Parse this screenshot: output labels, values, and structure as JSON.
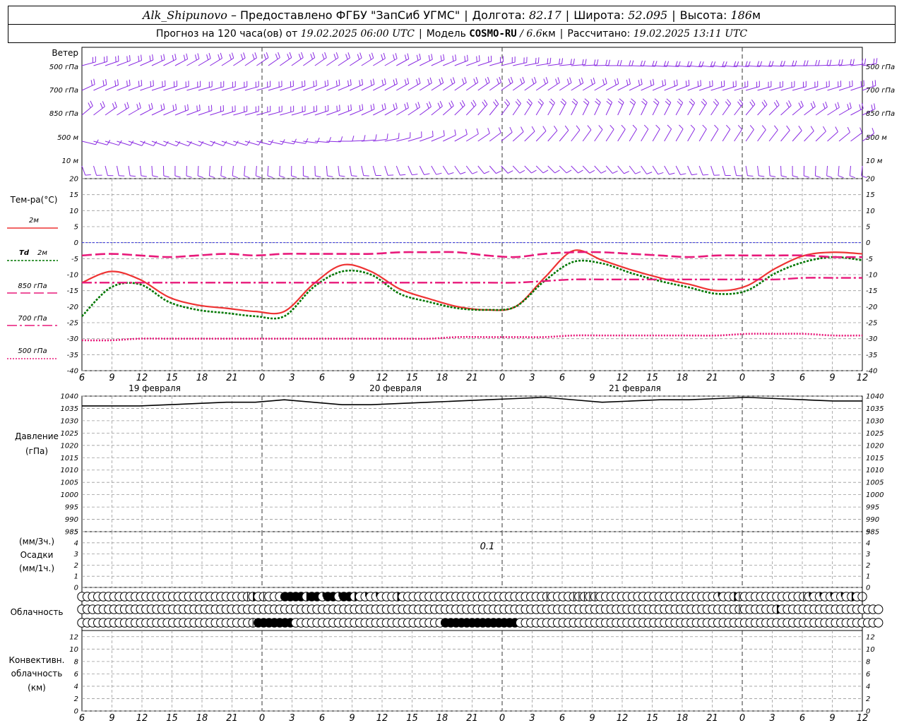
{
  "header": {
    "station": "Alk_Shipunovo",
    "provider_prefix": "– Предоставлено ФГБУ",
    "provider_name": "\"ЗапСиб УГМС\"",
    "lon_label": "Долгота:",
    "lon_value": "82.17",
    "lat_label": "Широта:",
    "lat_value": "52.095",
    "alt_label": "Высота:",
    "alt_value": "186",
    "alt_unit": "м",
    "forecast_prefix": "Прогноз на 120 часа(ов) от",
    "forecast_start": "19.02.2025 06:00 UTC",
    "model_label": "Модель",
    "model_name": "COSMO-RU",
    "model_res": "/ 6.6",
    "model_res_unit": "км",
    "computed_label": "Рассчитано:",
    "computed_value": "19.02.2025 13:11 UTC"
  },
  "colors": {
    "wind": "#8a2be2",
    "t2m": "#ee3333",
    "td2m": "#007700",
    "t850": "#e8197a",
    "t700": "#e8197a",
    "t500": "#e8197a",
    "zero": "#3333dd",
    "pressure": "#000000",
    "grid": "#9a9a9a"
  },
  "labels": {
    "wind": "Ветер",
    "levels": [
      "500 гПа",
      "700 гПа",
      "850 гПа",
      "500 м",
      "10 м"
    ],
    "temp_title": "Тем-ра(°С)",
    "leg_2m": "2м",
    "leg_td": "Td",
    "leg_td_2m": "2м",
    "leg_850": "850 гПа",
    "leg_700": "700 гПа",
    "leg_500": "500 гПа",
    "pressure_title": "Давление",
    "pressure_unit": "(гПа)",
    "precip_unit3": "(мм/3ч.)",
    "precip_title": "Осадки",
    "precip_unit1": "(мм/1ч.)",
    "precip_annot": "0.1",
    "cloud_title": "Облачность",
    "conv_title1": "Конвективн.",
    "conv_title2": "облачность",
    "conv_unit": "(км)"
  },
  "chart_data": {
    "type": "line",
    "x_hours": [
      6,
      9,
      12,
      15,
      18,
      21,
      0,
      3,
      6,
      9,
      12,
      15,
      18,
      21,
      0,
      3,
      6,
      9,
      12,
      15,
      18,
      21,
      0,
      3,
      6,
      9,
      12
    ],
    "day_labels": [
      "19 февраля",
      "20 февраля",
      "21 февраля"
    ],
    "temperature": {
      "ylim": [
        -40,
        20
      ],
      "ticks": [
        20,
        15,
        10,
        5,
        0,
        -5,
        -10,
        -15,
        -20,
        -25,
        -30,
        -35,
        -40
      ],
      "series": [
        {
          "name": "2м",
          "values": [
            -12.5,
            -9,
            -11.5,
            -17,
            -19.5,
            -20.5,
            -21.5,
            -21.5,
            -13,
            -7,
            -9,
            -14.5,
            -17.5,
            -20,
            -21,
            -20,
            -11,
            -2.5,
            -5.5,
            -8.5,
            -11,
            -13,
            -15,
            -13.5,
            -8,
            -4,
            -3,
            -3.5
          ]
        },
        {
          "name": "Td 2м",
          "values": [
            -23,
            -14,
            -13,
            -18.5,
            -21,
            -22,
            -23,
            -23,
            -14,
            -9,
            -10,
            -16,
            -18.5,
            -20.5,
            -21,
            -20,
            -12,
            -6,
            -6.5,
            -9.5,
            -12,
            -14,
            -16,
            -15,
            -9.5,
            -6,
            -4.5,
            -5.5
          ]
        },
        {
          "name": "850 гПа",
          "values": [
            -4,
            -3.5,
            -4,
            -4.5,
            -4,
            -3.5,
            -4,
            -3.5,
            -3.5,
            -3.5,
            -3.5,
            -3,
            -3,
            -3,
            -4,
            -4.5,
            -3.5,
            -3,
            -3,
            -3.5,
            -4,
            -4.5,
            -4,
            -4,
            -4,
            -4,
            -4.5,
            -4.5
          ]
        },
        {
          "name": "700 гПа",
          "values": [
            -12.5,
            -12.5,
            -12.5,
            -12.5,
            -12.5,
            -12.5,
            -12.5,
            -12.5,
            -12.5,
            -12.5,
            -12.5,
            -12.5,
            -12.5,
            -12.5,
            -12.5,
            -12.5,
            -12,
            -11.5,
            -11.5,
            -11.5,
            -11.5,
            -11.5,
            -11.5,
            -11.5,
            -11.5,
            -11,
            -11,
            -11
          ]
        },
        {
          "name": "500 гПа",
          "values": [
            -30.5,
            -30.5,
            -30,
            -30,
            -30,
            -30,
            -30,
            -30,
            -30,
            -30,
            -30,
            -30,
            -30,
            -29.5,
            -29.5,
            -29.5,
            -29.5,
            -29,
            -29,
            -29,
            -29,
            -29,
            -29,
            -28.5,
            -28.5,
            -28.5,
            -29,
            -29
          ]
        }
      ]
    },
    "pressure": {
      "ylim": [
        985,
        1040
      ],
      "ticks": [
        1040,
        1035,
        1030,
        1025,
        1020,
        1015,
        1010,
        1005,
        1000,
        995,
        990,
        985
      ],
      "values": [
        1036,
        1036,
        1036,
        1036.5,
        1037,
        1037.5,
        1037.5,
        1038.5,
        1037.5,
        1036.5,
        1036.5,
        1037,
        1037.5,
        1038,
        1038.5,
        1039,
        1039.5,
        1038.5,
        1037.5,
        1038,
        1038.5,
        1038.5,
        1039,
        1039.5,
        1039,
        1038.5,
        1038,
        1038
      ]
    },
    "precipitation": {
      "ylim": [
        0,
        5
      ],
      "ticks": [
        5,
        4,
        3,
        2,
        1,
        0
      ],
      "values": [
        0,
        0,
        0,
        0,
        0,
        0,
        0,
        0,
        0,
        0,
        0,
        0,
        0,
        0,
        0,
        0,
        0,
        0,
        0,
        0,
        0,
        0,
        0,
        0,
        0,
        0,
        0,
        0
      ]
    },
    "convective_cloud": {
      "ylim": [
        0,
        13
      ],
      "ticks": [
        12,
        10,
        8,
        6,
        4,
        2,
        0
      ]
    },
    "cloud_cover": {
      "rows": [
        "000000000000000000000000000000013010004444344244244302020003000000000000000000000000000100001111100000000000000000000002003100000000000120202020301",
        "000000000000000000000000000000000000000000000000000000000000000000000000000000000000000000000000000000000000000000000000000100000030000000000000000000",
        "000000000000000000000000000000001444444400000000000000000000000000004444444444444400000000000000000000000000000000000000000000000000000000000000000000"
      ]
    }
  }
}
